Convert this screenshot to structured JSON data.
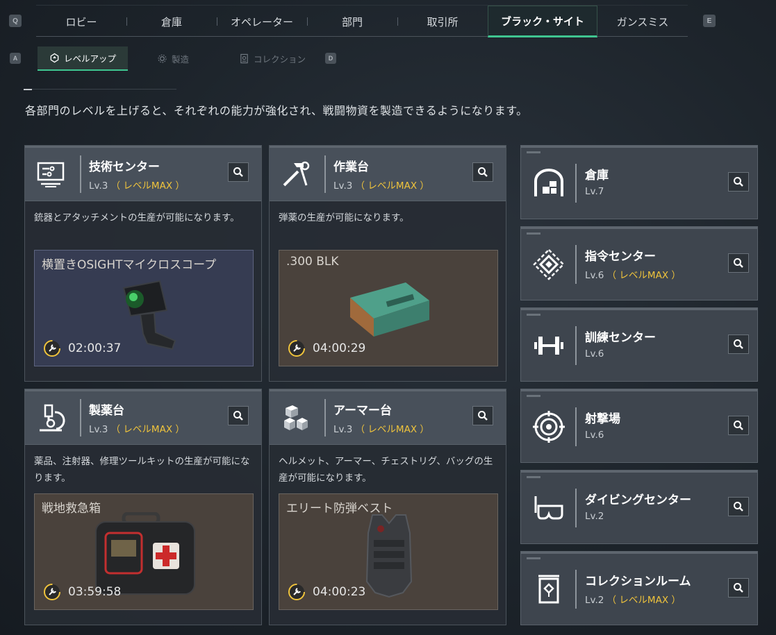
{
  "keys": {
    "prev_tab": "Q",
    "next_tab": "E",
    "prev_sub": "A",
    "next_sub": "D"
  },
  "top_tabs": [
    "ロビー",
    "倉庫",
    "オペレーター",
    "部門",
    "取引所",
    "ブラック・サイト",
    "ガンスミス"
  ],
  "active_top_tab": "ブラック・サイト",
  "sub_tabs": [
    {
      "label": "レベルアップ",
      "icon": "level-up-icon",
      "active": true
    },
    {
      "label": "製造",
      "icon": "gear-icon",
      "active": false
    },
    {
      "label": "コレクション",
      "icon": "collection-icon",
      "active": false
    }
  ],
  "description": "各部門のレベルを上げると、それぞれの能力が強化され、戦闘物資を製造できるようになります。",
  "cards": [
    {
      "name": "技術センター",
      "level": "Lv.3",
      "max": "（ レベルMAX ）",
      "icon": "tech-center-icon",
      "text": "銃器とアタッチメントの生産が可能になります。",
      "slot": {
        "title": "横置きOSIGHTマイクロスコープ",
        "timer": "02:00:37"
      }
    },
    {
      "name": "作業台",
      "level": "Lv.3",
      "max": "（ レベルMAX ）",
      "icon": "workbench-icon",
      "text": "弾薬の生産が可能になります。",
      "slot": {
        "title": ".300 BLK",
        "timer": "04:00:29"
      }
    },
    {
      "name": "製薬台",
      "level": "Lv.3",
      "max": "（ レベルMAX ）",
      "icon": "microscope-icon",
      "text": "薬品、注射器、修理ツールキットの生産が可能になります。",
      "slot": {
        "title": "戦地救急箱",
        "timer": "03:59:58"
      }
    },
    {
      "name": "アーマー台",
      "level": "Lv.3",
      "max": "（ レベルMAX ）",
      "icon": "armor-bench-icon",
      "text": "ヘルメット、アーマー、チェストリグ、バッグの生産が可能になります。",
      "slot": {
        "title": "エリート防弾ベスト",
        "timer": "04:00:23"
      }
    }
  ],
  "side_cards": [
    {
      "name": "倉庫",
      "level": "Lv.7",
      "max": "",
      "icon": "storage-icon"
    },
    {
      "name": "指令センター",
      "level": "Lv.6",
      "max": "（ レベルMAX ）",
      "icon": "command-center-icon"
    },
    {
      "name": "訓練センター",
      "level": "Lv.6",
      "max": "",
      "icon": "dumbbell-icon"
    },
    {
      "name": "射撃場",
      "level": "Lv.6",
      "max": "",
      "icon": "target-icon"
    },
    {
      "name": "ダイビングセンター",
      "level": "Lv.2",
      "max": "",
      "icon": "diving-mask-icon"
    },
    {
      "name": "コレクションルーム",
      "level": "Lv.2",
      "max": "（ レベルMAX ）",
      "icon": "collection-room-icon"
    }
  ],
  "colors": {
    "accent": "#3fc590",
    "max": "#f0c43c"
  }
}
